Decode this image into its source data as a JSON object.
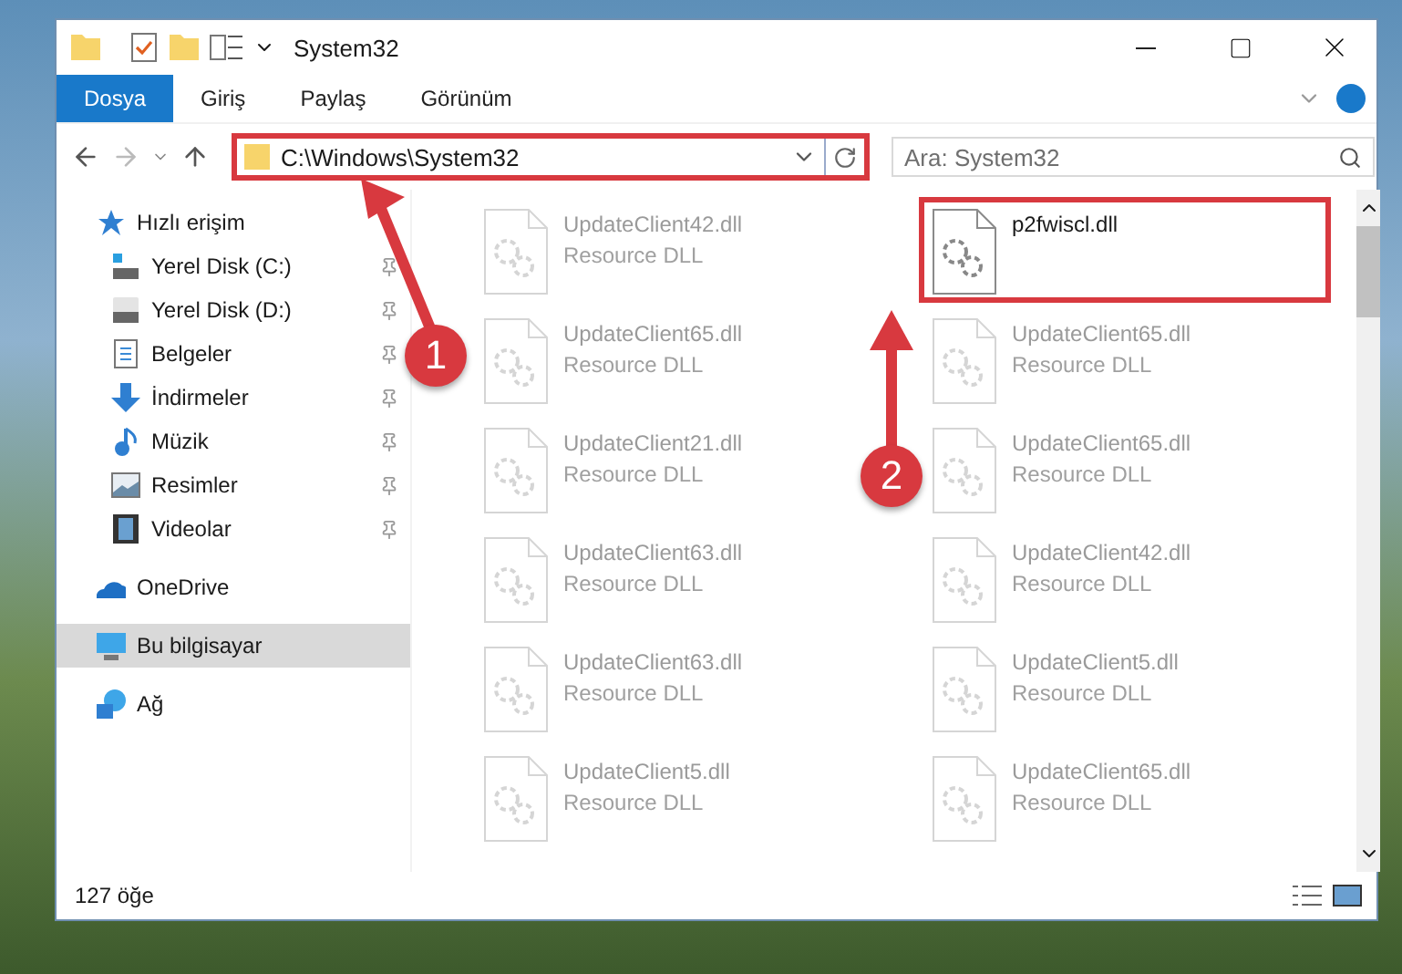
{
  "window": {
    "title": "System32"
  },
  "ribbon_tabs": [
    {
      "label": "Dosya",
      "selected": true
    },
    {
      "label": "Giriş",
      "selected": false
    },
    {
      "label": "Paylaş",
      "selected": false
    },
    {
      "label": "Görünüm",
      "selected": false
    }
  ],
  "address_bar": {
    "path": "C:\\Windows\\System32",
    "highlighted": true
  },
  "search": {
    "placeholder": "Ara: System32"
  },
  "sidebar": {
    "items": [
      {
        "label": "Hızlı erişim",
        "selected": false,
        "children": [
          {
            "label": "Yerel Disk (C:)",
            "pinned": true
          },
          {
            "label": "Yerel Disk (D:)",
            "pinned": true
          },
          {
            "label": "Belgeler",
            "pinned": true
          },
          {
            "label": "İndirmeler",
            "pinned": true
          },
          {
            "label": "Müzik",
            "pinned": true
          },
          {
            "label": "Resimler",
            "pinned": true
          },
          {
            "label": "Videolar",
            "pinned": true
          }
        ]
      },
      {
        "label": "OneDrive",
        "selected": false
      },
      {
        "label": "Bu bilgisayar",
        "selected": true
      },
      {
        "label": "Ağ",
        "selected": false
      }
    ]
  },
  "files": [
    {
      "name": "UpdateClient42.dll",
      "type": "Resource DLL",
      "dimmed": true,
      "highlighted": false
    },
    {
      "name": "p2fwiscl.dll",
      "dimmed": false,
      "highlighted": true
    },
    {
      "name": "UpdateClient65.dll",
      "type": "Resource DLL",
      "dimmed": true,
      "highlighted": false
    },
    {
      "name": "UpdateClient65.dll",
      "type": "Resource DLL",
      "dimmed": true,
      "highlighted": false
    },
    {
      "name": "UpdateClient21.dll",
      "type": "Resource DLL",
      "dimmed": true,
      "highlighted": false
    },
    {
      "name": "UpdateClient65.dll",
      "type": "Resource DLL",
      "dimmed": true,
      "highlighted": false
    },
    {
      "name": "UpdateClient63.dll",
      "type": "Resource DLL",
      "dimmed": true,
      "highlighted": false
    },
    {
      "name": "UpdateClient42.dll",
      "type": "Resource DLL",
      "dimmed": true,
      "highlighted": false
    },
    {
      "name": "UpdateClient63.dll",
      "type": "Resource DLL",
      "dimmed": true,
      "highlighted": false
    },
    {
      "name": "UpdateClient5.dll",
      "type": "Resource DLL",
      "dimmed": true,
      "highlighted": false
    },
    {
      "name": "UpdateClient5.dll",
      "type": "Resource DLL",
      "dimmed": true,
      "highlighted": false
    },
    {
      "name": "UpdateClient65.dll",
      "type": "Resource DLL",
      "dimmed": true,
      "highlighted": false
    }
  ],
  "status_bar": {
    "item_count": "127 öğe"
  },
  "annotations": [
    {
      "number": "1"
    },
    {
      "number": "2"
    }
  ]
}
